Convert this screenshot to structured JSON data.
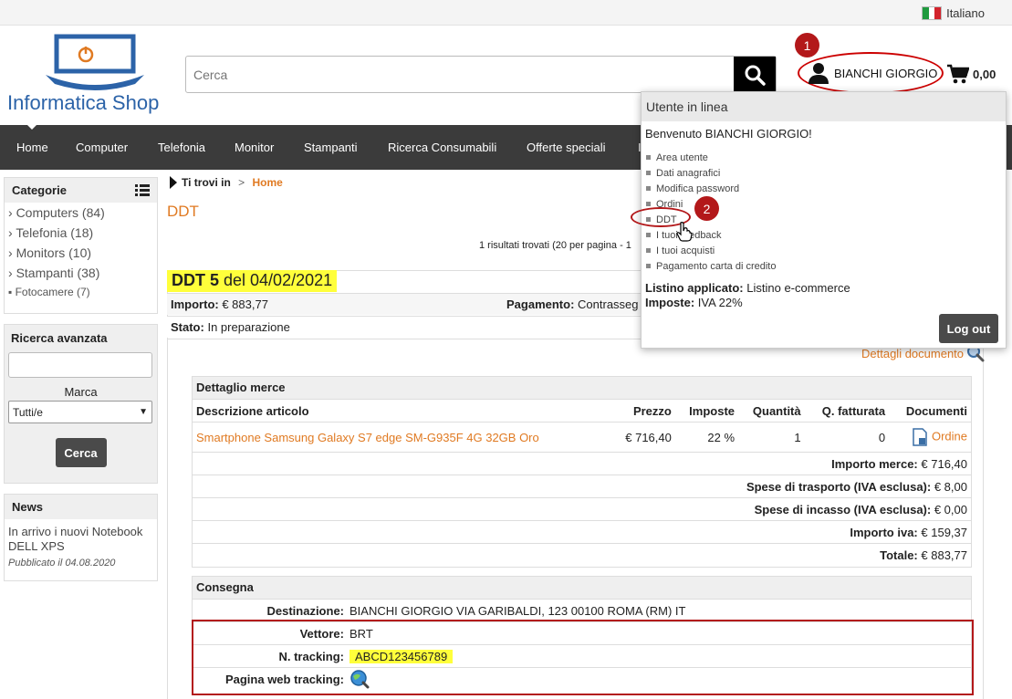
{
  "top": {
    "language": "Italiano"
  },
  "header": {
    "logo_text": "Informatica Shop",
    "search_placeholder": "Cerca",
    "user_name": "BIANCHI GIORGIO",
    "cart_total": "0,00",
    "step1": "1",
    "step2": "2"
  },
  "nav": [
    "Home",
    "Computer",
    "Telefonia",
    "Monitor",
    "Stampanti",
    "Ricerca Consumabili",
    "Offerte speciali",
    "I"
  ],
  "sidebar": {
    "categories_title": "Categorie",
    "categories": [
      "Computers (84)",
      "Telefonia (18)",
      "Monitors (10)",
      "Stampanti (38)",
      "Fotocamere (7)"
    ],
    "advanced_title": "Ricerca avanzata",
    "brand_label": "Marca",
    "brand_value": "Tutti/e",
    "search_button": "Cerca",
    "news_title": "News",
    "news_text": "In arrivo i nuovi Notebook DELL XPS",
    "news_date": "Pubblicato il 04.08.2020"
  },
  "breadcrumb": {
    "prefix": "Ti trovi in",
    "sep": " > ",
    "current": "Home"
  },
  "page_title": "DDT",
  "results_text": "1 risultati trovati (20 per pagina - 1",
  "doc": {
    "title_bold": "DDT 5",
    "title_rest": " del 04/02/2021",
    "importo_label": "Importo:",
    "importo_value": "€ 883,77",
    "pagamento_label": "Pagamento:",
    "pagamento_value": "Contrasseg",
    "stato_label": "Stato:",
    "stato_value": "In preparazione",
    "dettagli_link": "Dettagli documento"
  },
  "detail": {
    "title": "Dettaglio merce",
    "columns": [
      "Descrizione articolo",
      "Prezzo",
      "Imposte",
      "Quantità",
      "Q. fatturata",
      "Documenti"
    ],
    "row": {
      "description": "Smartphone Samsung Galaxy S7 edge SM-G935F 4G 32GB Oro",
      "price": "€ 716,40",
      "tax": "22 %",
      "qty": "1",
      "qty_invoiced": "0",
      "document": "Ordine"
    },
    "summary": [
      {
        "label": "Importo merce:",
        "value": "€ 716,40"
      },
      {
        "label": "Spese di trasporto (IVA esclusa):",
        "value": "€ 8,00"
      },
      {
        "label": "Spese di incasso (IVA esclusa):",
        "value": "€ 0,00"
      },
      {
        "label": "Importo iva:",
        "value": "€ 159,37"
      },
      {
        "label": "Totale:",
        "value": "€ 883,77"
      }
    ]
  },
  "delivery": {
    "title": "Consegna",
    "destination_label": "Destinazione:",
    "destination_value": "BIANCHI GIORGIO VIA GARIBALDI, 123 00100 ROMA (RM) IT",
    "carrier_label": "Vettore:",
    "carrier_value": "BRT",
    "tracking_label": "N. tracking:",
    "tracking_value": "ABCD123456789",
    "web_label": "Pagina web tracking:"
  },
  "dropdown": {
    "title": "Utente in linea",
    "welcome": "Benvenuto BIANCHI GIORGIO!",
    "items": [
      "Area utente",
      "Dati anagrafici",
      "Modifica password",
      "Ordini",
      "DDT",
      "I tuoi feedback",
      "I tuoi acquisti",
      "Pagamento carta di credito"
    ],
    "listino_label": "Listino applicato:",
    "listino_value": "Listino e-commerce",
    "imposte_label": "Imposte:",
    "imposte_value": "IVA 22%",
    "logout": "Log out"
  },
  "colors": {
    "accent": "#e07a22",
    "nav_bg": "#3b3b3b",
    "highlight": "#ffff3b",
    "annotation_red": "#b3181a",
    "logo_blue": "#2c63a8"
  }
}
